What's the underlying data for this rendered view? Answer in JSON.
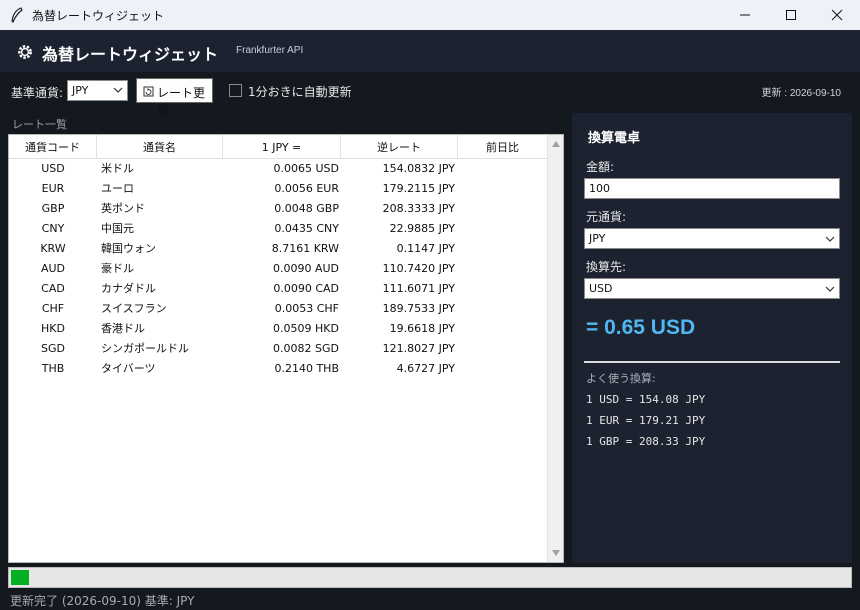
{
  "window": {
    "title": "為替レートウィジェット"
  },
  "header": {
    "title": "為替レートウィジェット",
    "api": "Frankfurter API"
  },
  "toolbar": {
    "base_label": "基準通貨:",
    "base_value": "JPY",
    "refresh_label": "レート更新",
    "auto_label": "1分おきに自動更新",
    "auto_checked": false,
    "update_info": "更新 : 2026-09-10"
  },
  "rates": {
    "title": "レート一覧",
    "columns": [
      "通貨コード",
      "通貨名",
      "1 JPY =",
      "逆レート",
      "前日比"
    ],
    "rows": [
      {
        "code": "USD",
        "name": "米ドル",
        "rate": "0.0065 USD",
        "inverse": "154.0832 JPY",
        "change": ""
      },
      {
        "code": "EUR",
        "name": "ユーロ",
        "rate": "0.0056 EUR",
        "inverse": "179.2115 JPY",
        "change": ""
      },
      {
        "code": "GBP",
        "name": "英ポンド",
        "rate": "0.0048 GBP",
        "inverse": "208.3333 JPY",
        "change": ""
      },
      {
        "code": "CNY",
        "name": "中国元",
        "rate": "0.0435 CNY",
        "inverse": "22.9885 JPY",
        "change": ""
      },
      {
        "code": "KRW",
        "name": "韓国ウォン",
        "rate": "8.7161 KRW",
        "inverse": "0.1147 JPY",
        "change": ""
      },
      {
        "code": "AUD",
        "name": "豪ドル",
        "rate": "0.0090 AUD",
        "inverse": "110.7420 JPY",
        "change": ""
      },
      {
        "code": "CAD",
        "name": "カナダドル",
        "rate": "0.0090 CAD",
        "inverse": "111.6071 JPY",
        "change": ""
      },
      {
        "code": "CHF",
        "name": "スイスフラン",
        "rate": "0.0053 CHF",
        "inverse": "189.7533 JPY",
        "change": ""
      },
      {
        "code": "HKD",
        "name": "香港ドル",
        "rate": "0.0509 HKD",
        "inverse": "19.6618 JPY",
        "change": ""
      },
      {
        "code": "SGD",
        "name": "シンガポールドル",
        "rate": "0.0082 SGD",
        "inverse": "121.8027 JPY",
        "change": ""
      },
      {
        "code": "THB",
        "name": "タイバーツ",
        "rate": "0.2140 THB",
        "inverse": "4.6727 JPY",
        "change": ""
      }
    ]
  },
  "calculator": {
    "title": "換算電卓",
    "amount_label": "金額:",
    "amount_value": "100",
    "from_label": "元通貨:",
    "from_value": "JPY",
    "to_label": "換算先:",
    "to_value": "USD",
    "result": "= 0.65 USD",
    "common_title": "よく使う換算:",
    "common": [
      "1 USD = 154.08 JPY",
      "1 EUR = 179.21 JPY",
      "1 GBP = 208.33 JPY"
    ]
  },
  "progress": {
    "fraction": 0.022
  },
  "status": {
    "text": "更新完了 (2026-09-10) 基準: JPY"
  },
  "colors": {
    "accent": "#4fb8f0",
    "progress": "#06b025",
    "panel": "#1c2230",
    "background": "#14181f"
  },
  "icons": {
    "app": "feather-icon",
    "logo": "gear-icon",
    "refresh": "refresh-icon"
  }
}
